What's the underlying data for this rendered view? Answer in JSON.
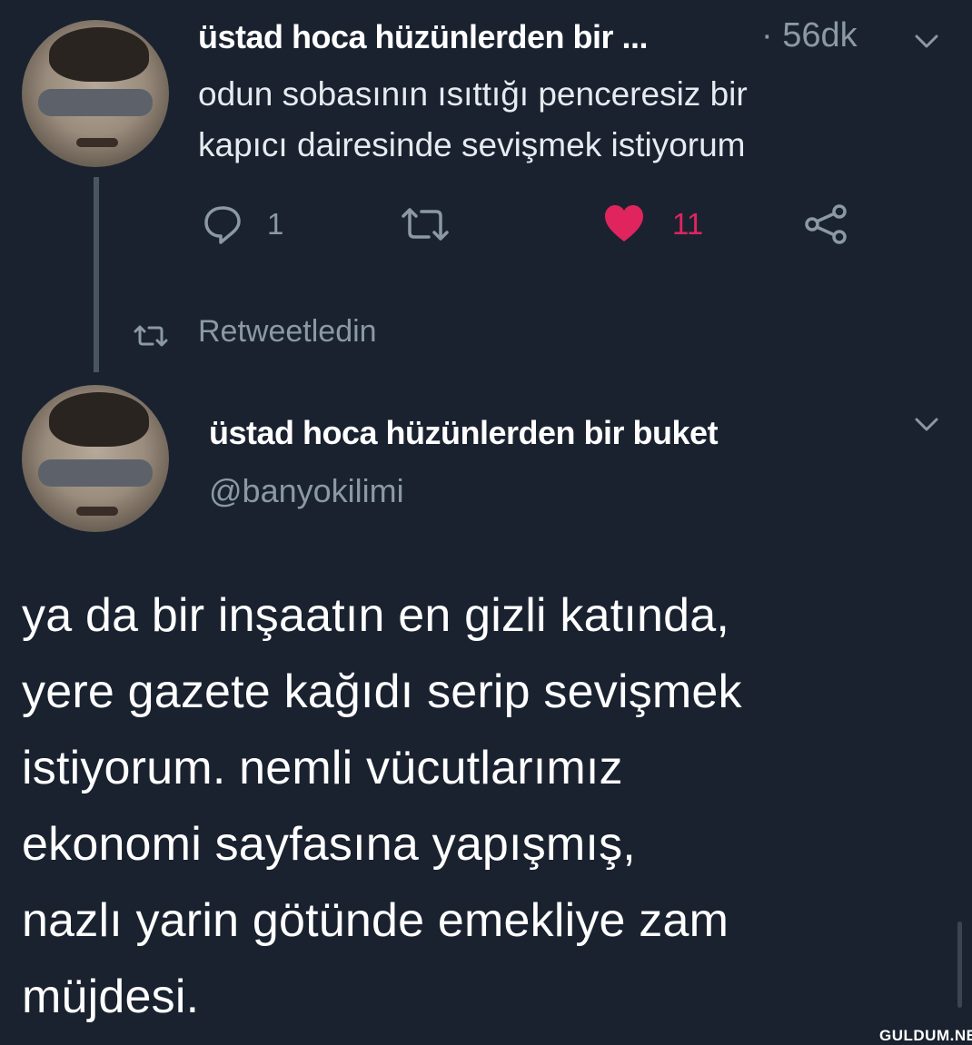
{
  "tweet": {
    "author_name": "üstad hoca hüzünlerden bir ...",
    "time": "· 56dk",
    "text_line1": "odun sobasının ısıttığı penceresiz bir",
    "text_line2": "kapıcı dairesinde sevişmek istiyorum",
    "reply_count": "1",
    "like_count": "11",
    "icons": {
      "reply": "reply-icon",
      "retweet": "retweet-icon",
      "like": "heart-icon",
      "share": "share-icon",
      "menu": "chevron-down-icon"
    }
  },
  "retweet_notice": {
    "label": "Retweetledin",
    "icon": "retweet-icon"
  },
  "quoted": {
    "author_name": "üstad hoca hüzünlerden bir buket",
    "handle": "@banyokilimi",
    "lines": [
      "ya da bir inşaatın en gizli katında,",
      "yere gazete kağıdı serip sevişmek",
      "istiyorum. nemli vücutlarımız",
      "ekonomi sayfasına yapışmış,",
      "nazlı yarin götünde emekliye zam",
      "müjdesi."
    ]
  },
  "watermark": "GULDUM.NET",
  "colors": {
    "background": "#1a2230",
    "like": "#e0245e",
    "muted": "#8b98a5",
    "text": "#ffffff"
  }
}
